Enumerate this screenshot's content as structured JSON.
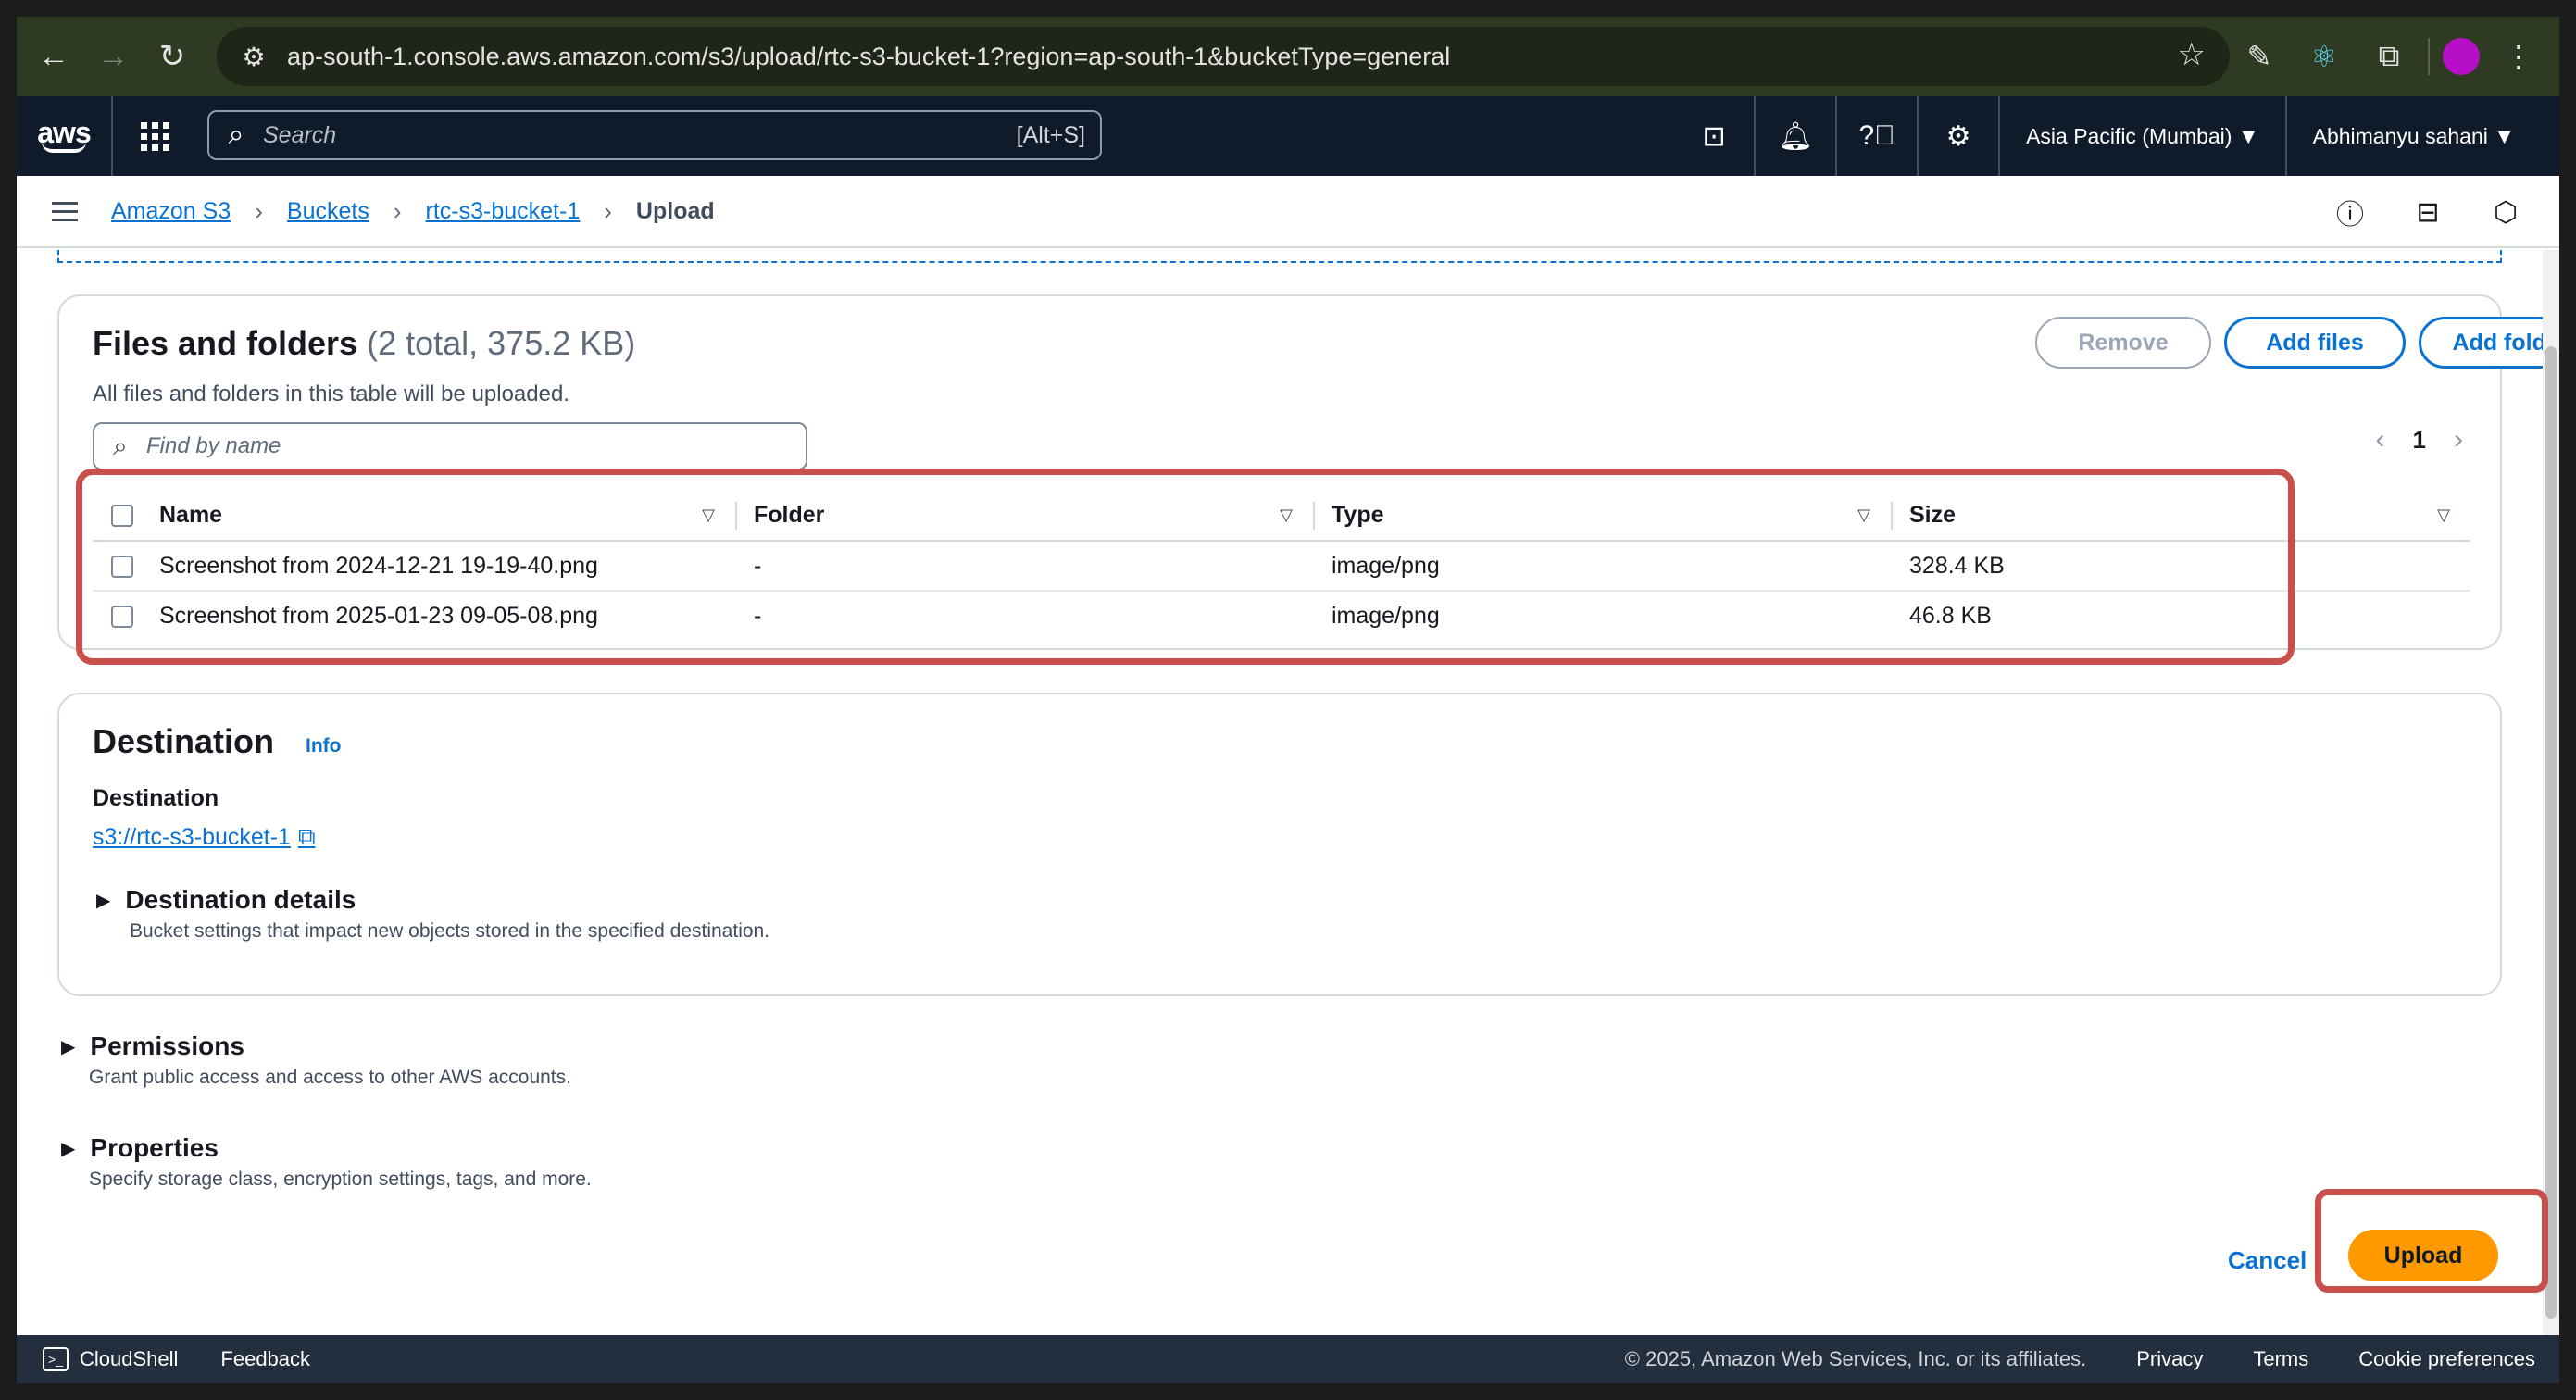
{
  "browser": {
    "url": "ap-south-1.console.aws.amazon.com/s3/upload/rtc-s3-bucket-1?region=ap-south-1&bucketType=general"
  },
  "awsnav": {
    "logo": "aws",
    "search_placeholder": "Search",
    "search_shortcut": "[Alt+S]",
    "region": "Asia Pacific (Mumbai) ▼",
    "user": "Abhimanyu sahani ▼"
  },
  "breadcrumb": {
    "items": [
      "Amazon S3",
      "Buckets",
      "rtc-s3-bucket-1"
    ],
    "current": "Upload"
  },
  "files_panel": {
    "title": "Files and folders",
    "count": "(2 total, 375.2 KB)",
    "description": "All files and folders in this table will be uploaded.",
    "remove_label": "Remove",
    "add_files_label": "Add files",
    "add_folder_label": "Add folder",
    "find_placeholder": "Find by name",
    "page": "1",
    "columns": [
      "Name",
      "Folder",
      "Type",
      "Size"
    ],
    "rows": [
      {
        "name": "Screenshot from 2024-12-21 19-19-40.png",
        "folder": "-",
        "type": "image/png",
        "size": "328.4 KB"
      },
      {
        "name": "Screenshot from 2025-01-23 09-05-08.png",
        "folder": "-",
        "type": "image/png",
        "size": "46.8 KB"
      }
    ]
  },
  "destination_panel": {
    "title": "Destination",
    "info": "Info",
    "label": "Destination",
    "link": "s3://rtc-s3-bucket-1",
    "details_title": "Destination details",
    "details_sub": "Bucket settings that impact new objects stored in the specified destination."
  },
  "permissions": {
    "title": "Permissions",
    "sub": "Grant public access and access to other AWS accounts."
  },
  "properties": {
    "title": "Properties",
    "sub": "Specify storage class, encryption settings, tags, and more."
  },
  "actions": {
    "cancel_label": "Cancel",
    "upload_label": "Upload"
  },
  "footer": {
    "cloudshell": "CloudShell",
    "feedback": "Feedback",
    "copyright": "© 2025, Amazon Web Services, Inc. or its affiliates.",
    "privacy": "Privacy",
    "terms": "Terms",
    "cookies": "Cookie preferences"
  },
  "colors": {
    "accent": "#0972d3",
    "primary_button": "#ff9900",
    "highlight_box": "#c9504a",
    "nav_bg": "#0f1b2a"
  }
}
